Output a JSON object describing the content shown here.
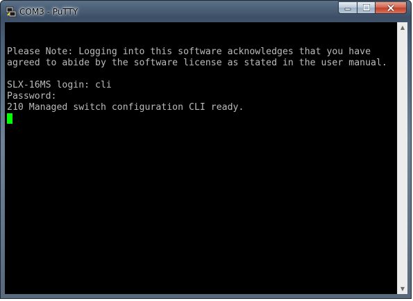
{
  "window": {
    "title": "COM3 - PuTTY",
    "app_icon": "putty-icon"
  },
  "caption_buttons": {
    "minimize": "minimize-icon",
    "maximize": "maximize-icon",
    "close": "close-icon"
  },
  "terminal": {
    "lines": [
      "",
      "Please Note: Logging into this software acknowledges that you have",
      "agreed to abide by the software license as stated in the user manual.",
      "",
      "SLX-16MS login: cli",
      "Password:",
      "210 Managed switch configuration CLI ready."
    ],
    "cursor_color": "#00ff00",
    "text_color": "#bbbbbb",
    "background_color": "#000000"
  },
  "scrollbar": {
    "up_icon": "scroll-up-arrow-icon",
    "down_icon": "scroll-down-arrow-icon"
  }
}
